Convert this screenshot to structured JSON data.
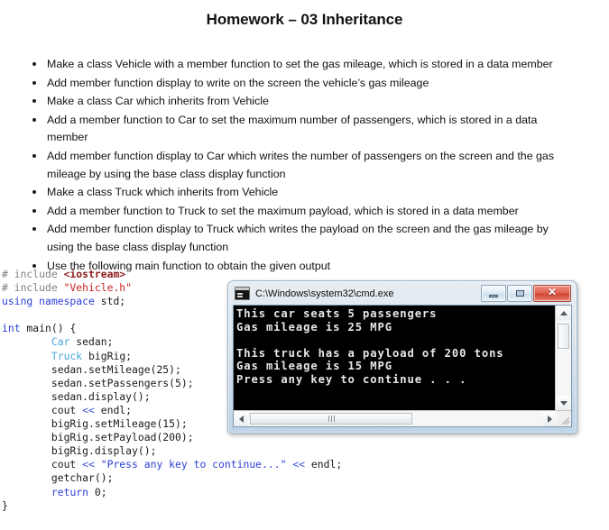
{
  "document": {
    "title": "Homework – 03 Inheritance"
  },
  "tasks": [
    "Make a class Vehicle with a member function to set the gas mileage, which is stored in a data member",
    "Add member function display to write on the screen the vehicle’s gas mileage",
    "Make a class Car which inherits from Vehicle",
    "Add a member function to Car to set the maximum number of passengers, which is stored in a data member",
    "Add member function display to Car which writes the number of passengers on the screen and the gas mileage by using the base class display function",
    "Make a class Truck which inherits from Vehicle",
    "Add a member function to Truck to set the maximum payload, which is stored in a data member",
    "Add member function display to Truck which writes the payload on the screen and the gas mileage by using the base class display function",
    "Use the following main function to obtain the given output"
  ],
  "code": {
    "language": "cpp",
    "lines": [
      [
        {
          "t": "# include ",
          "c": "pre"
        },
        {
          "t": "<iostream>",
          "c": "hdr"
        }
      ],
      [
        {
          "t": "# include ",
          "c": "pre"
        },
        {
          "t": "\"Vehicle.h\"",
          "c": "str"
        }
      ],
      [
        {
          "t": "using namespace ",
          "c": "kw"
        },
        {
          "t": "std;",
          "c": "plain"
        }
      ],
      [
        {
          "t": "",
          "c": "plain"
        }
      ],
      [
        {
          "t": "int",
          "c": "kw"
        },
        {
          "t": " main() {",
          "c": "plain"
        }
      ],
      [
        {
          "t": "        ",
          "c": "plain"
        },
        {
          "t": "Car",
          "c": "type"
        },
        {
          "t": " sedan;",
          "c": "plain"
        }
      ],
      [
        {
          "t": "        ",
          "c": "plain"
        },
        {
          "t": "Truck",
          "c": "type"
        },
        {
          "t": " bigRig;",
          "c": "plain"
        }
      ],
      [
        {
          "t": "        sedan.setMileage(25);",
          "c": "plain"
        }
      ],
      [
        {
          "t": "        sedan.setPassengers(5);",
          "c": "plain"
        }
      ],
      [
        {
          "t": "        sedan.display();",
          "c": "plain"
        }
      ],
      [
        {
          "t": "        cout ",
          "c": "plain"
        },
        {
          "t": "<<",
          "c": "op"
        },
        {
          "t": " endl;",
          "c": "plain"
        }
      ],
      [
        {
          "t": "        bigRig.setMileage(15);",
          "c": "plain"
        }
      ],
      [
        {
          "t": "        bigRig.setPayload(200);",
          "c": "plain"
        }
      ],
      [
        {
          "t": "        bigRig.display();",
          "c": "plain"
        }
      ],
      [
        {
          "t": "        cout ",
          "c": "plain"
        },
        {
          "t": "<<",
          "c": "op"
        },
        {
          "t": " ",
          "c": "plain"
        },
        {
          "t": "\"Press any key to continue...\"",
          "c": "strb"
        },
        {
          "t": " ",
          "c": "plain"
        },
        {
          "t": "<<",
          "c": "op"
        },
        {
          "t": " endl;",
          "c": "plain"
        }
      ],
      [
        {
          "t": "        getchar();",
          "c": "plain"
        }
      ],
      [
        {
          "t": "        ",
          "c": "plain"
        },
        {
          "t": "return",
          "c": "kw"
        },
        {
          "t": " 0;",
          "c": "plain"
        }
      ],
      [
        {
          "t": "}",
          "c": "plain"
        }
      ]
    ]
  },
  "console": {
    "title": "C:\\Windows\\system32\\cmd.exe",
    "icon": "cmd-icon",
    "buttons": {
      "minimize": "minimize",
      "maximize": "maximize",
      "close": "✕"
    },
    "output": "This car seats 5 passengers\nGas mileage is 25 MPG\n\nThis truck has a payload of 200 tons\nGas mileage is 15 MPG\nPress any key to continue . . .",
    "scroll": {
      "vertical_up": "scroll-up",
      "vertical_down": "scroll-down",
      "horizontal_left": "scroll-left",
      "horizontal_right": "scroll-right"
    }
  },
  "colors": {
    "preprocessor": "#808080",
    "header": "#8B1A1A",
    "string_red": "#cc2222",
    "keyword": "#2b3fd8",
    "type": "#49a6dd",
    "operator": "#3a52d6",
    "console_bg": "#000000",
    "console_fg": "#e8e8e8",
    "close_button": "#cf4330"
  }
}
